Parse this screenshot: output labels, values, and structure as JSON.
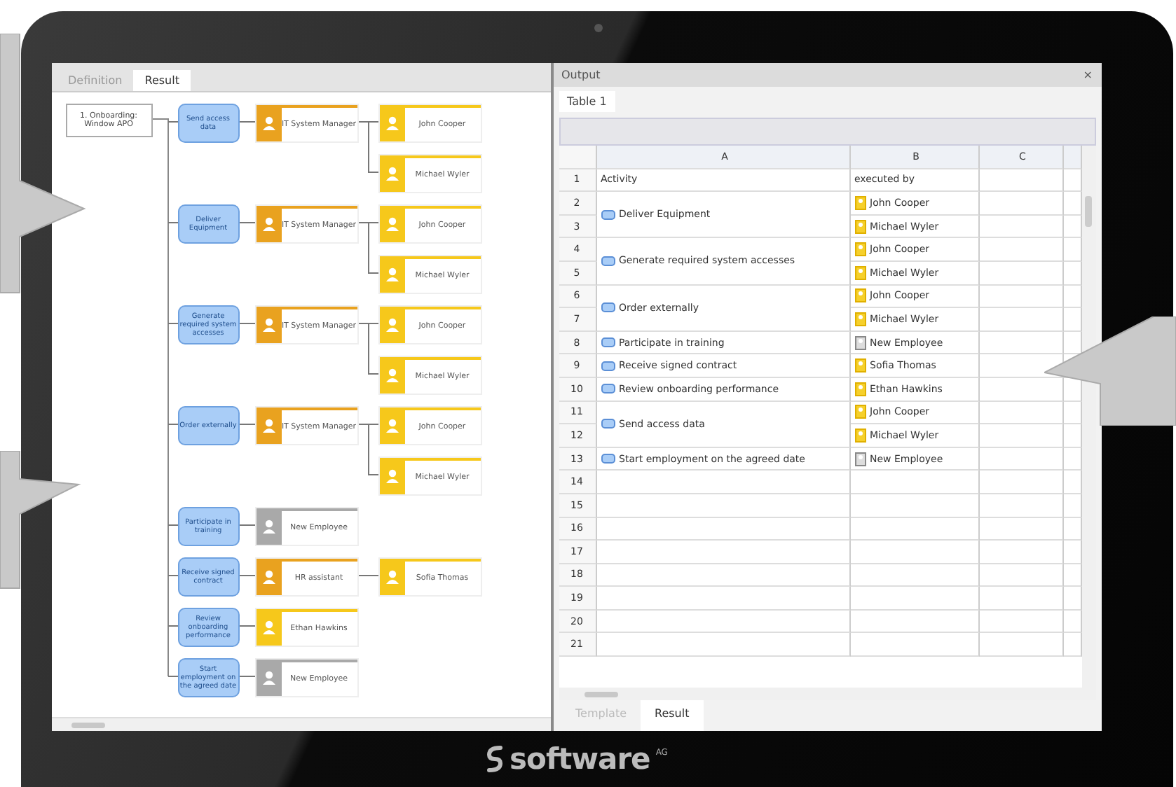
{
  "diagram": {
    "tabs": [
      {
        "label": "Definition",
        "selected": false
      },
      {
        "label": "Result",
        "selected": true
      }
    ],
    "root": "1. Onboarding: Window APO",
    "activities": [
      {
        "label": "Send access data",
        "performers": [
          {
            "kind": "manager",
            "label": "IT System Manager",
            "children": [
              {
                "kind": "person",
                "label": "John Cooper"
              },
              {
                "kind": "person",
                "label": "Michael Wyler"
              }
            ]
          }
        ]
      },
      {
        "label": "Deliver Equipment",
        "performers": [
          {
            "kind": "manager",
            "label": "IT System Manager",
            "children": [
              {
                "kind": "person",
                "label": "John Cooper"
              },
              {
                "kind": "person",
                "label": "Michael Wyler"
              }
            ]
          }
        ]
      },
      {
        "label": "Generate required system accesses",
        "performers": [
          {
            "kind": "manager",
            "label": "IT System Manager",
            "children": [
              {
                "kind": "person",
                "label": "John Cooper"
              },
              {
                "kind": "person",
                "label": "Michael Wyler"
              }
            ]
          }
        ]
      },
      {
        "label": "Order externally",
        "performers": [
          {
            "kind": "manager",
            "label": "IT System Manager",
            "children": [
              {
                "kind": "person",
                "label": "John Cooper"
              },
              {
                "kind": "person",
                "label": "Michael Wyler"
              }
            ]
          }
        ]
      },
      {
        "label": "Participate in training",
        "performers": [
          {
            "kind": "generic",
            "label": "New Employee"
          }
        ]
      },
      {
        "label": "Receive signed contract",
        "performers": [
          {
            "kind": "manager",
            "label": "HR assistant",
            "children": [
              {
                "kind": "person",
                "label": "Sofia Thomas"
              }
            ]
          }
        ]
      },
      {
        "label": "Review onboarding performance",
        "performers": [
          {
            "kind": "person",
            "label": "Ethan Hawkins"
          }
        ]
      },
      {
        "label": "Start employment on the agreed date",
        "performers": [
          {
            "kind": "generic",
            "label": "New Employee"
          }
        ]
      }
    ]
  },
  "output": {
    "title": "Output",
    "close": "×",
    "sheet_tab": "Table 1",
    "columns": [
      "A",
      "B",
      "C"
    ],
    "header_row": {
      "number": "1",
      "activity": "Activity",
      "executed_by": "executed by"
    },
    "groups": [
      {
        "activity": "Deliver Equipment",
        "performers": [
          {
            "number": "2",
            "name": "John Cooper",
            "kind": "person"
          },
          {
            "number": "3",
            "name": "Michael Wyler",
            "kind": "person"
          }
        ]
      },
      {
        "activity": "Generate required system accesses",
        "performers": [
          {
            "number": "4",
            "name": "John Cooper",
            "kind": "person"
          },
          {
            "number": "5",
            "name": "Michael Wyler",
            "kind": "person"
          }
        ]
      },
      {
        "activity": "Order externally",
        "performers": [
          {
            "number": "6",
            "name": "John Cooper",
            "kind": "person"
          },
          {
            "number": "7",
            "name": "Michael Wyler",
            "kind": "person"
          }
        ]
      },
      {
        "activity": "Participate in training",
        "performers": [
          {
            "number": "8",
            "name": "New Employee",
            "kind": "generic"
          }
        ]
      },
      {
        "activity": "Receive signed contract",
        "performers": [
          {
            "number": "9",
            "name": "Sofia Thomas",
            "kind": "person"
          }
        ]
      },
      {
        "activity": "Review onboarding performance",
        "performers": [
          {
            "number": "10",
            "name": "Ethan Hawkins",
            "kind": "person"
          }
        ]
      },
      {
        "activity": "Send access data",
        "performers": [
          {
            "number": "11",
            "name": "John Cooper",
            "kind": "person"
          },
          {
            "number": "12",
            "name": "Michael Wyler",
            "kind": "person"
          }
        ]
      },
      {
        "activity": "Start employment on the agreed date",
        "performers": [
          {
            "number": "13",
            "name": "New Employee",
            "kind": "generic"
          }
        ]
      }
    ],
    "empty_rows": [
      "14",
      "15",
      "16",
      "17",
      "18",
      "19",
      "20",
      "21"
    ],
    "bottom_tabs": [
      {
        "label": "Template",
        "selected": false
      },
      {
        "label": "Result",
        "selected": true
      }
    ]
  },
  "logo": {
    "name": "software",
    "suffix": "AG"
  }
}
